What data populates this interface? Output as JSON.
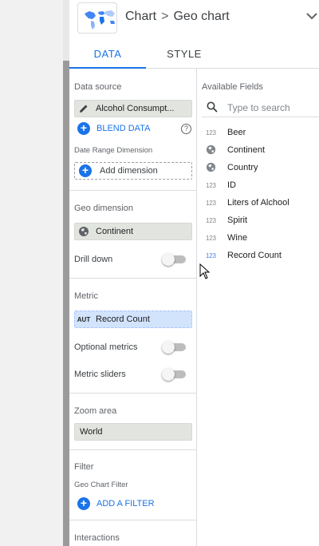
{
  "header": {
    "breadcrumb_root": "Chart",
    "breadcrumb_separator": ">",
    "breadcrumb_current": "Geo chart",
    "chevron_icon": "chevron-down-icon"
  },
  "tabs": [
    {
      "label": "DATA",
      "active": true
    },
    {
      "label": "STYLE",
      "active": false
    }
  ],
  "left_panel": {
    "data_source": {
      "title": "Data source",
      "source_name": "Alcohol Consumpt...",
      "source_icon": "pencil-icon",
      "blend_label": "BLEND DATA",
      "help_icon": "help-circle-icon"
    },
    "date_range": {
      "title": "Date Range Dimension",
      "add_label": "Add dimension"
    },
    "geo_dimension": {
      "title": "Geo dimension",
      "value": "Continent",
      "icon": "globe-icon"
    },
    "drill_down": {
      "label": "Drill down",
      "on": false
    },
    "metric": {
      "title": "Metric",
      "aggregation": "AUT",
      "value": "Record Count"
    },
    "optional_metrics": {
      "label": "Optional metrics",
      "on": false
    },
    "metric_sliders": {
      "label": "Metric sliders",
      "on": false
    },
    "zoom_area": {
      "title": "Zoom area",
      "value": "World"
    },
    "filter": {
      "title": "Filter",
      "subtitle": "Geo Chart Filter",
      "add_label": "ADD A FILTER"
    },
    "interactions": {
      "title": "Interactions"
    }
  },
  "right_panel": {
    "title": "Available Fields",
    "search_placeholder": "Type to search",
    "search_icon": "search-icon",
    "fields": [
      {
        "type": "123",
        "name": "Beer",
        "type_color": "#80868b"
      },
      {
        "type": "globe",
        "name": "Continent",
        "type_color": "#80868b"
      },
      {
        "type": "globe",
        "name": "Country",
        "type_color": "#80868b"
      },
      {
        "type": "123",
        "name": "ID",
        "type_color": "#80868b"
      },
      {
        "type": "123",
        "name": "Liters of Alchool",
        "type_color": "#80868b"
      },
      {
        "type": "123",
        "name": "Spirit",
        "type_color": "#80868b"
      },
      {
        "type": "123",
        "name": "Wine",
        "type_color": "#80868b"
      },
      {
        "type": "123",
        "name": "Record Count",
        "type_color": "#4285f4"
      }
    ]
  },
  "colors": {
    "accent": "#1a73e8",
    "chip_bg": "#e2e5df",
    "metric_chip_bg": "#d2e3fc",
    "gutter": "#9a9a9a"
  }
}
